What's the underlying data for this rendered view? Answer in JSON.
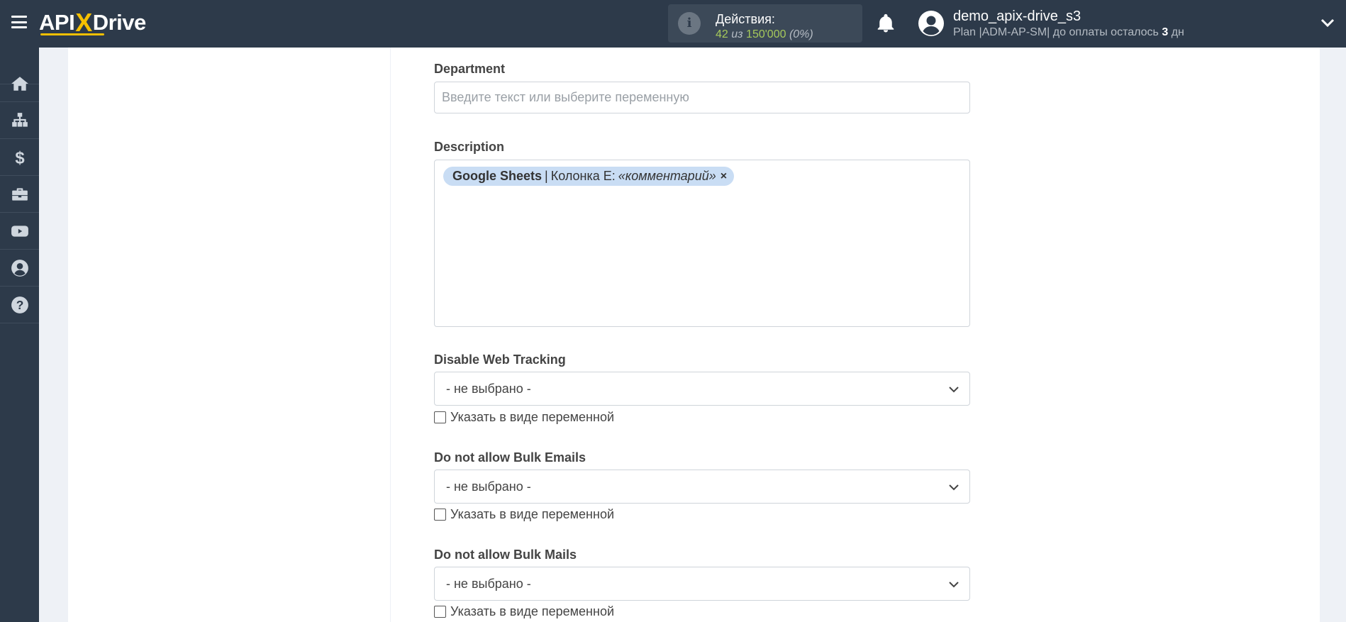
{
  "header": {
    "logo": {
      "api": "API",
      "x": "X",
      "drive": "Drive"
    },
    "actions": {
      "title": "Действия:",
      "used": "42",
      "of": "из",
      "total": "150'000",
      "percent": "(0%)"
    },
    "user": {
      "name": "demo_apix-drive_s3",
      "plan_prefix": "Plan |ADM-AP-SM| до оплаты осталось",
      "days": "3",
      "days_suffix": "дн"
    }
  },
  "sidebar": {
    "items": [
      {
        "name": "home-icon"
      },
      {
        "name": "sitemap-icon"
      },
      {
        "name": "dollar-icon"
      },
      {
        "name": "briefcase-icon"
      },
      {
        "name": "youtube-icon"
      },
      {
        "name": "user-icon"
      },
      {
        "name": "help-icon"
      }
    ]
  },
  "form": {
    "department": {
      "label": "Department",
      "placeholder": "Введите текст или выберите переменную"
    },
    "description": {
      "label": "Description",
      "tag": {
        "source": "Google Sheets",
        "separator": "|",
        "column": "Колонка E:",
        "variable": "«комментарий»",
        "remove": "×"
      }
    },
    "disable_web_tracking": {
      "label": "Disable Web Tracking",
      "value": "- не выбрано -",
      "checkbox_label": "Указать в виде переменной"
    },
    "bulk_emails": {
      "label": "Do not allow Bulk Emails",
      "value": "- не выбрано -",
      "checkbox_label": "Указать в виде переменной"
    },
    "bulk_mails": {
      "label": "Do not allow Bulk Mails",
      "value": "- не выбрано -",
      "checkbox_label": "Указать в виде переменной"
    }
  },
  "colors": {
    "header_bg": "#2d3a4a",
    "accent": "#f6c000",
    "stats_green": "#a6c95b",
    "tag_bg": "#c9ddf4"
  }
}
